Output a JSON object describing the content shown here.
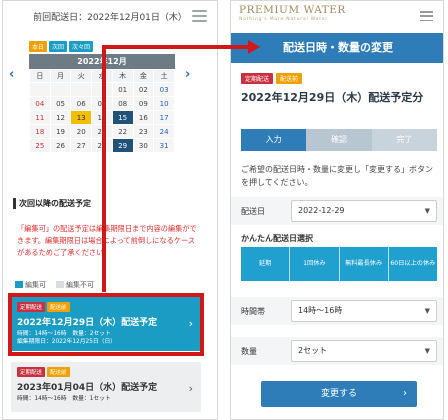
{
  "left": {
    "title": "前回配送日：2022年12月01日（木）",
    "legend_tags": [
      "本日",
      "次回",
      "次々回"
    ],
    "calendar": {
      "month_label": "2022年12月",
      "weekdays": [
        "日",
        "月",
        "火",
        "水",
        "木",
        "金",
        "土"
      ],
      "rows": [
        [
          "",
          "",
          "",
          "",
          "01",
          "02",
          "03"
        ],
        [
          "04",
          "05",
          "06",
          "07",
          "08",
          "09",
          "10"
        ],
        [
          "11",
          "12",
          "13",
          "14",
          "15",
          "16",
          "17"
        ],
        [
          "18",
          "19",
          "20",
          "21",
          "22",
          "23",
          "24"
        ],
        [
          "25",
          "26",
          "27",
          "28",
          "29",
          "30",
          "31"
        ]
      ],
      "prev_icon": "‹",
      "next_icon": "›"
    },
    "next_section_title": "次回以降の配送予定",
    "notice": "「編集可」の配送予定は編集期限日まで内容の編集ができます。編集期限日は場合によって前倒しになるケースがあるためご了承ください。",
    "legend": {
      "editable": "編集可",
      "not_editable": "編集不可"
    },
    "cards": [
      {
        "badges": [
          "定期配送",
          "配送前"
        ],
        "date": "2022年12月29日（木）配送予定",
        "line1": "時間：14時〜16時　数量：2セット",
        "line2": "編集期限日：2022年12月25日（日）"
      },
      {
        "badges": [
          "定期配送",
          "配送前"
        ],
        "date": "2023年01月04日（水）配送予定",
        "line1": "時間：14時〜16時　数量：1セット",
        "line2": ""
      }
    ]
  },
  "right": {
    "logo": "PREMIUM WATER",
    "logo_sub": "Nothing's More Natural Water",
    "header": "配送日時・数量の変更",
    "badges": [
      "定期配送",
      "配送前"
    ],
    "date_title": "2022年12月29日（木）配送予定分",
    "steps": [
      "入力",
      "確認",
      "完了"
    ],
    "description": "ご希望の配送日時・数量に変更し「変更する」ボタンを押してください。",
    "delivery_date": {
      "label": "配送日",
      "value": "2022-12-29"
    },
    "easy": {
      "title": "かんたん配送日選択",
      "options": [
        "延期",
        "1回休み",
        "無料最長休み",
        "60日以上の休み"
      ]
    },
    "time": {
      "label": "時間帯",
      "value": "14時〜16時"
    },
    "quantity": {
      "label": "数量",
      "value": "2セット"
    },
    "submit": "変更する"
  },
  "colors": {
    "accent_blue": "#2e7db9",
    "teal": "#1a9cc4",
    "highlight_red": "#d01818"
  }
}
